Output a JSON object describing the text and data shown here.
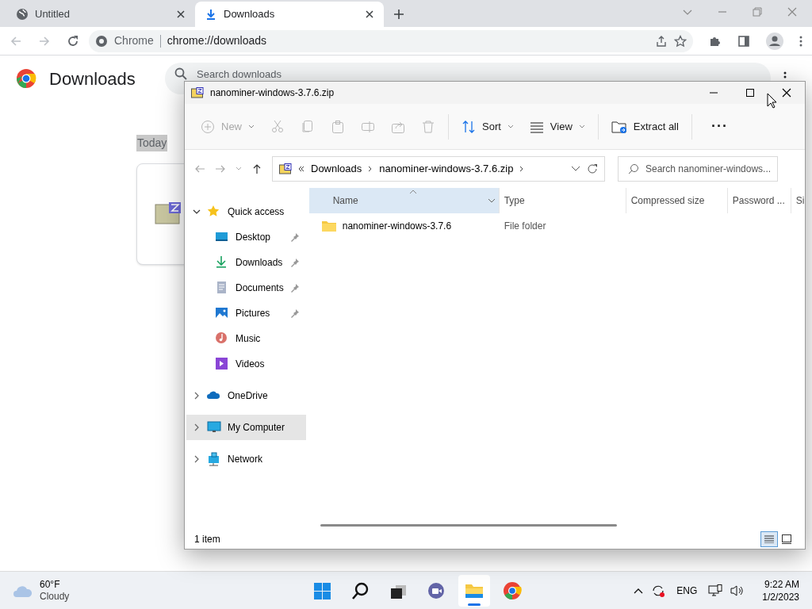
{
  "browser": {
    "tabs": [
      {
        "title": "Untitled",
        "kind": "globe",
        "selected": false
      },
      {
        "title": "Downloads",
        "kind": "download",
        "selected": true
      }
    ],
    "address": {
      "site": "Chrome",
      "url": "chrome://downloads"
    },
    "page": {
      "title": "Downloads",
      "search_placeholder": "Search downloads",
      "date_label": "Today"
    }
  },
  "explorer": {
    "title": "nanominer-windows-3.7.6.zip",
    "toolbar": [
      {
        "kind": "new",
        "label": "New",
        "disabled": true
      },
      {
        "kind": "cut",
        "disabled": true
      },
      {
        "kind": "copy",
        "disabled": true
      },
      {
        "kind": "paste",
        "disabled": true
      },
      {
        "kind": "rename",
        "disabled": true
      },
      {
        "kind": "share",
        "disabled": true
      },
      {
        "kind": "delete",
        "disabled": true
      },
      {
        "kind": "sort",
        "label": "Sort",
        "disabled": false
      },
      {
        "kind": "view",
        "label": "View",
        "disabled": false
      },
      {
        "kind": "extract",
        "label": "Extract all",
        "disabled": false
      },
      {
        "kind": "more",
        "label": "···",
        "disabled": false
      }
    ],
    "breadcrumb": [
      "Downloads",
      "nanominer-windows-3.7.6.zip"
    ],
    "search_placeholder": "Search nanominer-windows...",
    "nav": [
      {
        "label": "Quick access",
        "kind": "star",
        "expanded": true,
        "selected": false,
        "children": [
          {
            "label": "Desktop",
            "kind": "desktop",
            "pinned": true,
            "selected": false
          },
          {
            "label": "Downloads",
            "kind": "downloads",
            "pinned": true,
            "selected": false
          },
          {
            "label": "Documents",
            "kind": "documents",
            "pinned": true,
            "selected": false
          },
          {
            "label": "Pictures",
            "kind": "pictures",
            "pinned": true,
            "selected": false
          },
          {
            "label": "Music",
            "kind": "music",
            "pinned": false,
            "selected": false
          },
          {
            "label": "Videos",
            "kind": "videos",
            "pinned": false,
            "selected": false
          }
        ]
      },
      {
        "label": "OneDrive",
        "kind": "cloud",
        "expanded": false,
        "selected": false
      },
      {
        "label": "My Computer",
        "kind": "computer",
        "expanded": false,
        "selected": true
      },
      {
        "label": "Network",
        "kind": "network",
        "expanded": false,
        "selected": false
      }
    ],
    "columns": [
      {
        "label": "Name",
        "sorted": true
      },
      {
        "label": "Type",
        "sorted": false
      },
      {
        "label": "Compressed size",
        "sorted": false
      },
      {
        "label": "Password ...",
        "sorted": false
      },
      {
        "label": "Si",
        "sorted": false
      }
    ],
    "rows": [
      {
        "name": "nanominer-windows-3.7.6",
        "type": "File folder"
      }
    ],
    "status": "1 item"
  },
  "taskbar": {
    "temperature": "60°F",
    "weather": "Cloudy",
    "apps": [
      {
        "kind": "start",
        "active": false
      },
      {
        "kind": "search",
        "active": false
      },
      {
        "kind": "taskview",
        "active": false
      },
      {
        "kind": "chat",
        "active": false
      },
      {
        "kind": "explorer",
        "active": true
      },
      {
        "kind": "chrome",
        "active": false
      }
    ],
    "language": "ENG",
    "time": "9:22 AM",
    "date": "1/2/2023"
  }
}
